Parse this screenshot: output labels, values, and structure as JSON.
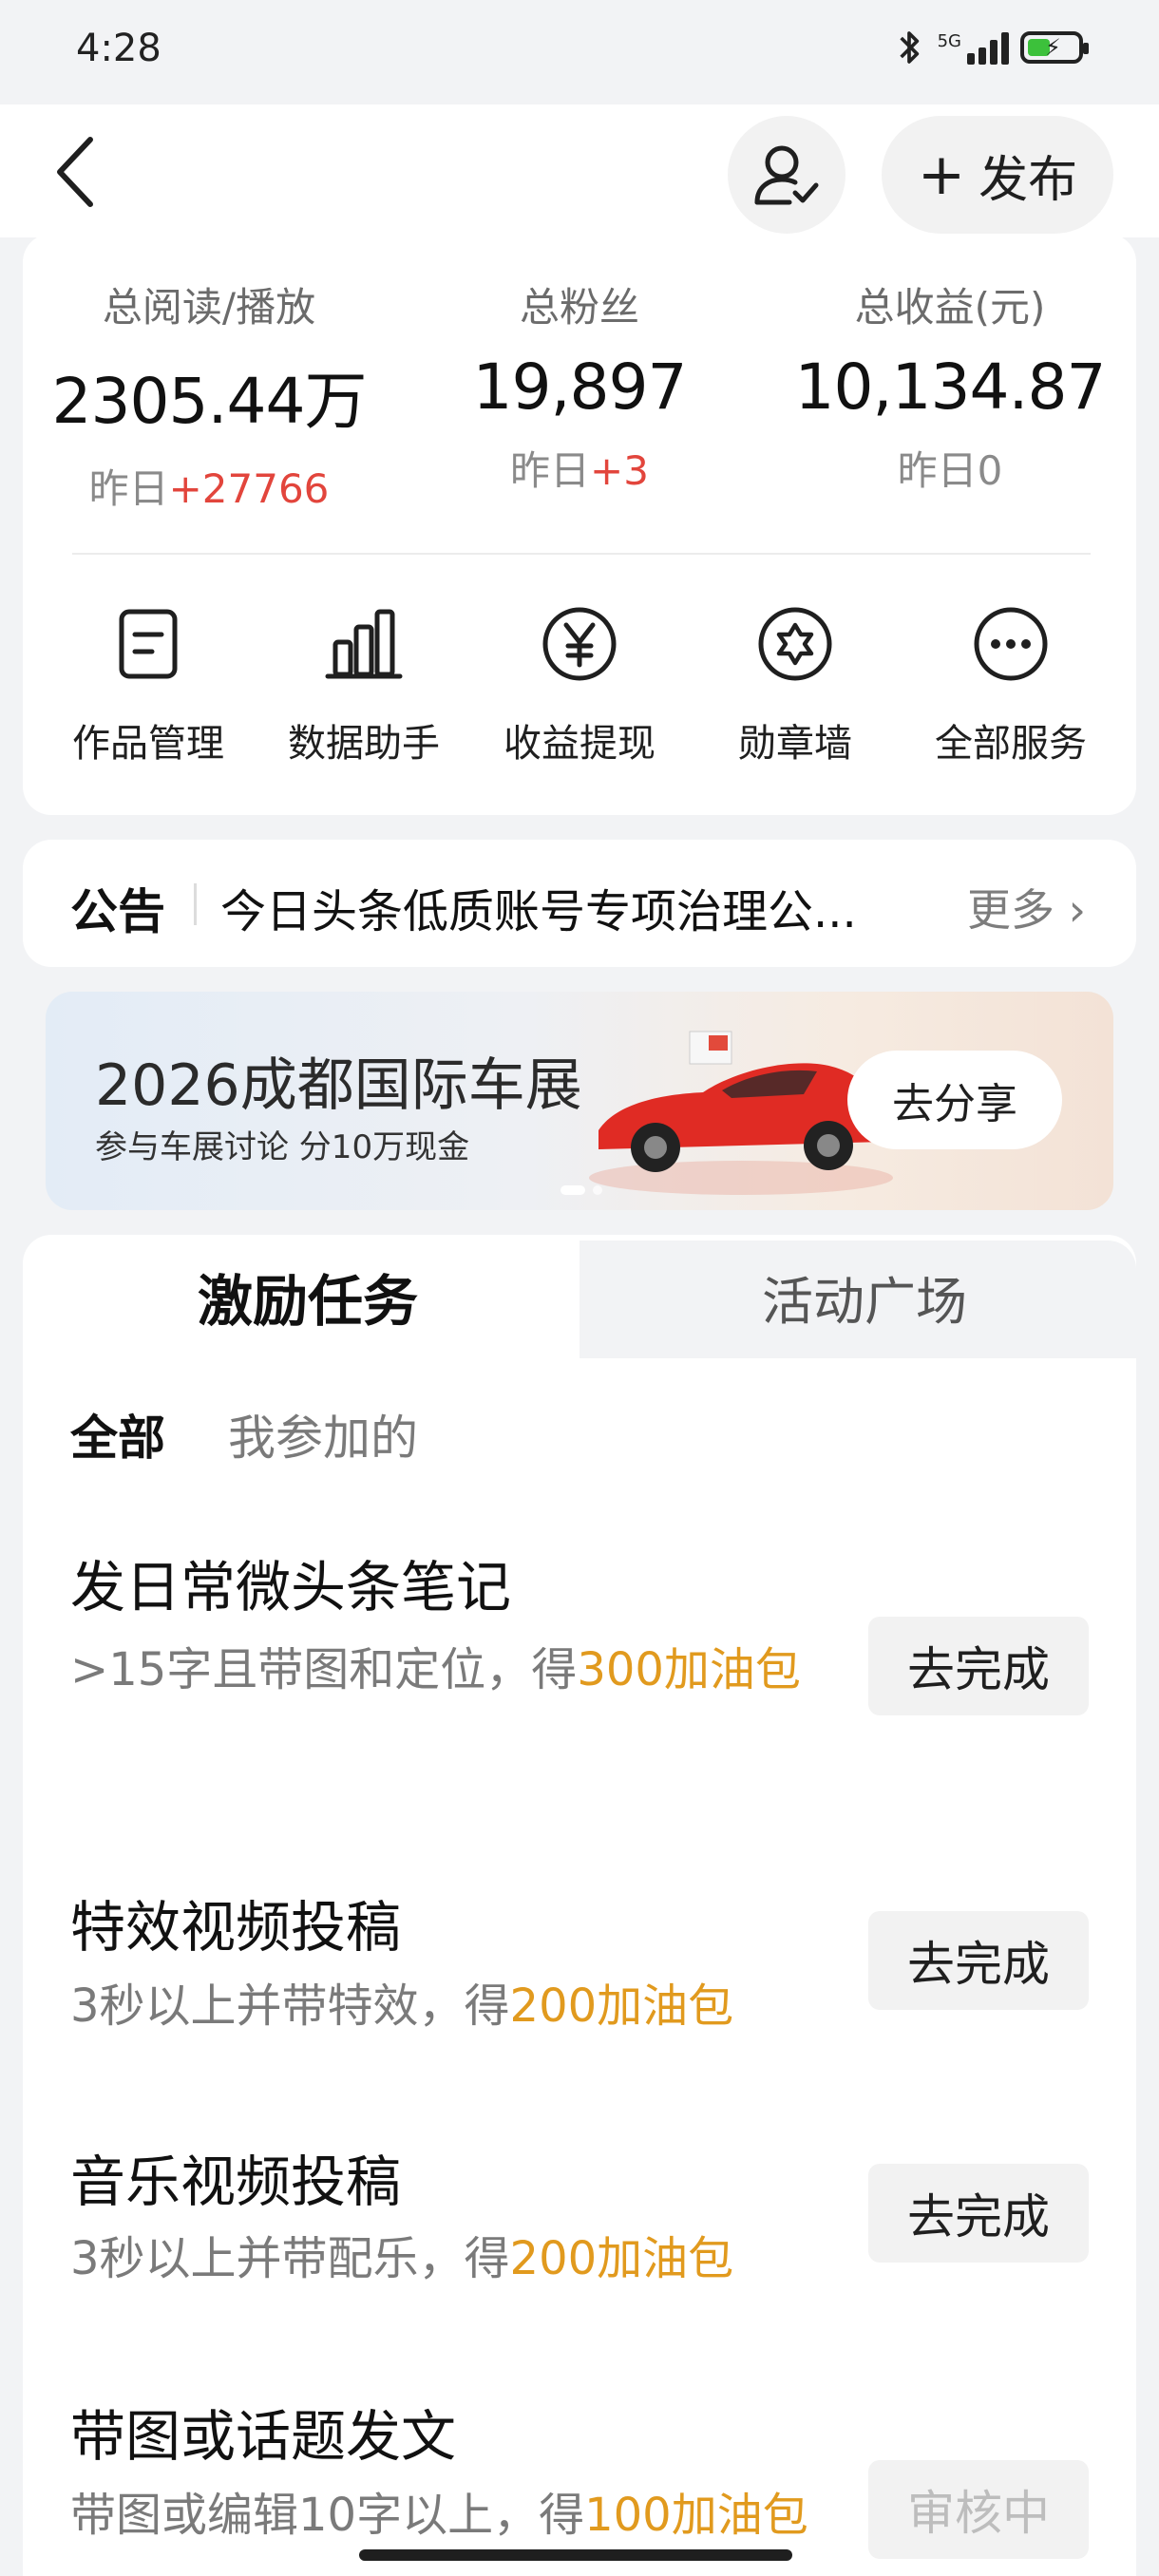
{
  "status_bar": {
    "time": "4:28",
    "network": "5G"
  },
  "header": {
    "publish_label": "发布"
  },
  "stats": [
    {
      "label": "总阅读/播放",
      "value": "2305.44万",
      "delta_prefix": "昨日",
      "delta": "+27766"
    },
    {
      "label": "总粉丝",
      "value": "19,897",
      "delta_prefix": "昨日",
      "delta": "+3"
    },
    {
      "label": "总收益(元)",
      "value": "10,134.87",
      "delta_prefix": "昨日",
      "delta": "0"
    }
  ],
  "services": [
    {
      "label": "作品管理",
      "icon": "document-icon"
    },
    {
      "label": "数据助手",
      "icon": "bar-chart-icon"
    },
    {
      "label": "收益提现",
      "icon": "yen-icon"
    },
    {
      "label": "勋章墙",
      "icon": "badge-star-icon"
    },
    {
      "label": "全部服务",
      "icon": "more-dots-icon"
    }
  ],
  "notice": {
    "title": "公告",
    "text": "今日头条低质账号专项治理公...",
    "more": "更多"
  },
  "banner": {
    "title": "2026成都国际车展",
    "subtitle": "参与车展讨论  分10万现金",
    "button": "去分享"
  },
  "tabs": {
    "active": "激励任务",
    "other": "活动广场"
  },
  "filters": {
    "all": "全部",
    "mine": "我参加的"
  },
  "tasks": [
    {
      "title": "发日常微头条笔记",
      "desc": ">15字且带图和定位，得",
      "reward": "300加油包",
      "button": "去完成"
    },
    {
      "title": "特效视频投稿",
      "desc": "3秒以上并带特效，得",
      "reward": "200加油包",
      "button": "去完成"
    },
    {
      "title": "音乐视频投稿",
      "desc": "3秒以上并带配乐，得",
      "reward": "200加油包",
      "button": "去完成"
    },
    {
      "title": "带图或话题发文",
      "desc": "带图或编辑10字以上，得",
      "reward": "100加油包",
      "button": "审核中"
    }
  ],
  "colors": {
    "positive_delta": "#e2453c",
    "reward": "#e19a1e",
    "page_bg": "#f2f3f5"
  }
}
